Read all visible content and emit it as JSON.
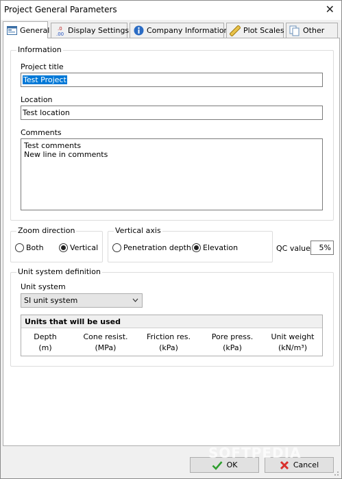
{
  "window": {
    "title": "Project General Parameters",
    "close_glyph": "✕"
  },
  "tabs": [
    {
      "label": "General",
      "icon": "general-tab-icon"
    },
    {
      "label": "Display Settings",
      "icon": "display-settings-icon"
    },
    {
      "label": "Company Information",
      "icon": "info-icon"
    },
    {
      "label": "Plot Scales",
      "icon": "ruler-icon"
    },
    {
      "label": "Other",
      "icon": "documents-icon"
    }
  ],
  "information": {
    "legend": "Information",
    "project_title_label": "Project title",
    "project_title_value": "Test Project",
    "location_label": "Location",
    "location_value": "Test location",
    "comments_label": "Comments",
    "comments_lines": [
      "Test comments",
      "New line in comments"
    ]
  },
  "zoom_direction": {
    "legend": "Zoom direction",
    "options": [
      {
        "label": "Both",
        "selected": false
      },
      {
        "label": "Vertical",
        "selected": true
      }
    ]
  },
  "vertical_axis": {
    "legend": "Vertical axis",
    "options": [
      {
        "label": "Penetration depth",
        "selected": false
      },
      {
        "label": "Elevation",
        "selected": true
      }
    ]
  },
  "qc_value": {
    "label": "QC value",
    "value": "5%"
  },
  "unit_system": {
    "legend": "Unit system definition",
    "label": "Unit system",
    "selected": "SI unit system",
    "units_header": "Units that will be used",
    "columns": [
      {
        "name": "Depth",
        "unit": "(m)"
      },
      {
        "name": "Cone resist.",
        "unit": "(MPa)"
      },
      {
        "name": "Friction res.",
        "unit": "(kPa)"
      },
      {
        "name": "Pore press.",
        "unit": "(kPa)"
      },
      {
        "name": "Unit weight",
        "unit": "(kN/m³)"
      }
    ]
  },
  "buttons": {
    "ok": "OK",
    "cancel": "Cancel"
  },
  "watermark": "SOFTPEDIA",
  "colors": {
    "selection": "#0078d7",
    "ok_check": "#2e9e2e",
    "cancel_x": "#d9302c"
  }
}
